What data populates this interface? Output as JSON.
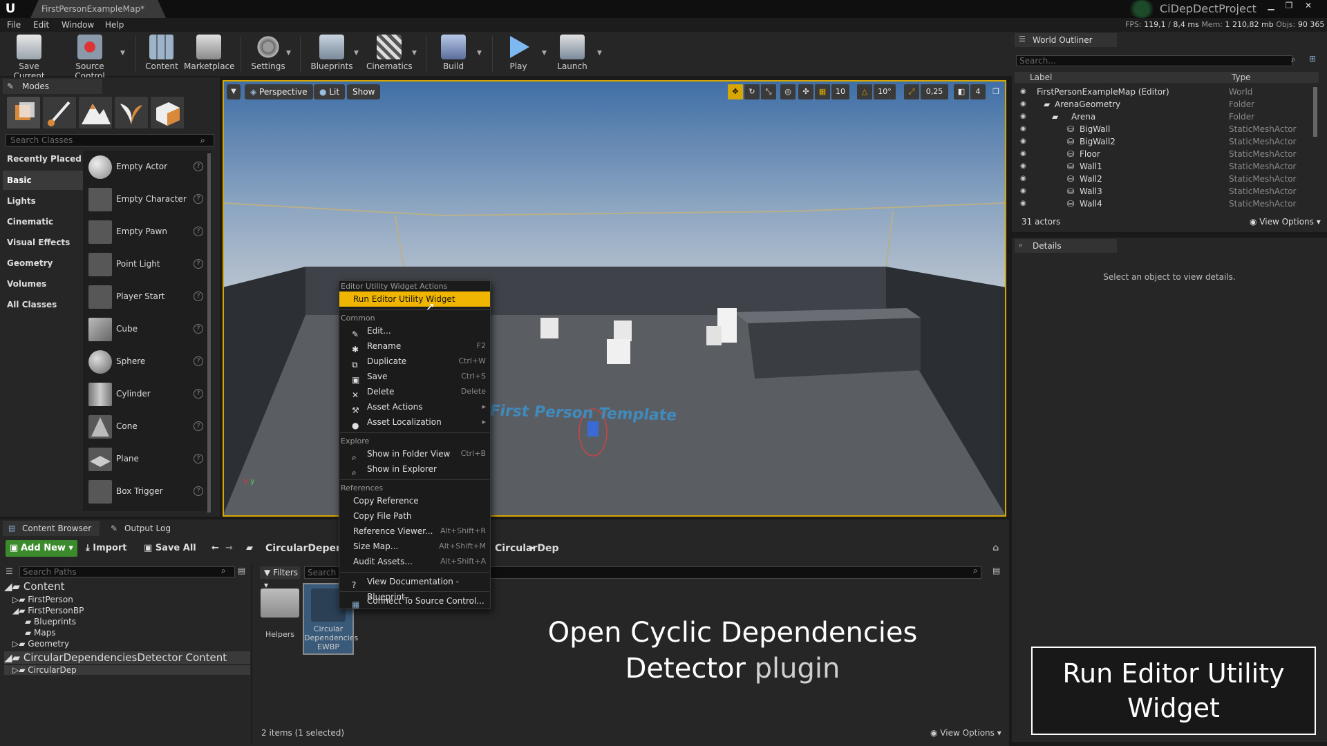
{
  "window": {
    "tab_title": "FirstPersonExampleMap*",
    "project_name": "CiDepDectProject"
  },
  "menu": [
    "File",
    "Edit",
    "Window",
    "Help"
  ],
  "stats": {
    "fps_label": "FPS:",
    "fps": "119,1",
    "ms": "8,4 ms",
    "mem_label": "Mem:",
    "mem": "1 210,82 mb",
    "objs_label": "Objs:",
    "objs": "90 365"
  },
  "toolbar": [
    "Save Current",
    "Source Control",
    "Content",
    "Marketplace",
    "Settings",
    "Blueprints",
    "Cinematics",
    "Build",
    "Play",
    "Launch"
  ],
  "modes": {
    "tab": "Modes",
    "search_placeholder": "Search Classes",
    "categories": [
      "Recently Placed",
      "Basic",
      "Lights",
      "Cinematic",
      "Visual Effects",
      "Geometry",
      "Volumes",
      "All Classes"
    ],
    "selected_category": "Basic",
    "classes": [
      "Empty Actor",
      "Empty Character",
      "Empty Pawn",
      "Point Light",
      "Player Start",
      "Cube",
      "Sphere",
      "Cylinder",
      "Cone",
      "Plane",
      "Box Trigger"
    ]
  },
  "viewport": {
    "perspective": "Perspective",
    "lit": "Lit",
    "show": "Show",
    "grid_snap": "10",
    "rot_snap": "10°",
    "scale_snap": "0,25",
    "cam_speed": "4",
    "floor_text": "First Person Template",
    "axis_x": "x",
    "axis_y": "y"
  },
  "outliner": {
    "tab": "World Outliner",
    "search_placeholder": "Search...",
    "col_label": "Label",
    "col_type": "Type",
    "rows": [
      {
        "label": "FirstPersonExampleMap (Editor)",
        "type": "World"
      },
      {
        "label": "ArenaGeometry",
        "type": "Folder"
      },
      {
        "label": "Arena",
        "type": "Folder"
      },
      {
        "label": "BigWall",
        "type": "StaticMeshActor"
      },
      {
        "label": "BigWall2",
        "type": "StaticMeshActor"
      },
      {
        "label": "Floor",
        "type": "StaticMeshActor"
      },
      {
        "label": "Wall1",
        "type": "StaticMeshActor"
      },
      {
        "label": "Wall2",
        "type": "StaticMeshActor"
      },
      {
        "label": "Wall3",
        "type": "StaticMeshActor"
      },
      {
        "label": "Wall4",
        "type": "StaticMeshActor"
      }
    ],
    "actor_count": "31 actors",
    "view_options": "View Options"
  },
  "details": {
    "tab": "Details",
    "empty_text": "Select an object to view details."
  },
  "content_browser": {
    "tab": "Content Browser",
    "output_log_tab": "Output Log",
    "add_new": "Add New",
    "import": "Import",
    "save_all": "Save All",
    "path_part1": "CircularDependencies",
    "path_part2": "CircularDep",
    "paths_search_placeholder": "Search Paths",
    "filters": "Filters",
    "assets_search_placeholder": "Search CircularDep",
    "tree": [
      "Content",
      "FirstPerson",
      "FirstPersonBP",
      "Blueprints",
      "Maps",
      "Geometry",
      "CircularDependenciesDetector Content",
      "CircularDep"
    ],
    "assets": [
      {
        "name": "Helpers"
      },
      {
        "name": "Circular Dependencies EWBP"
      }
    ],
    "count": "2 items (1 selected)",
    "view_options": "View Options"
  },
  "context_menu": {
    "header": "Editor Utility Widget Actions",
    "primary": "Run Editor Utility Widget",
    "sections": [
      {
        "title": "Common",
        "items": [
          {
            "label": "Edit...",
            "shortcut": ""
          },
          {
            "label": "Rename",
            "shortcut": "F2"
          },
          {
            "label": "Duplicate",
            "shortcut": "Ctrl+W"
          },
          {
            "label": "Save",
            "shortcut": "Ctrl+S"
          },
          {
            "label": "Delete",
            "shortcut": "Delete"
          },
          {
            "label": "Asset Actions",
            "shortcut": ""
          },
          {
            "label": "Asset Localization",
            "shortcut": ""
          }
        ]
      },
      {
        "title": "Explore",
        "items": [
          {
            "label": "Show in Folder View",
            "shortcut": "Ctrl+B"
          },
          {
            "label": "Show in Explorer",
            "shortcut": ""
          }
        ]
      },
      {
        "title": "References",
        "items": [
          {
            "label": "Copy Reference",
            "shortcut": ""
          },
          {
            "label": "Copy File Path",
            "shortcut": ""
          },
          {
            "label": "Reference Viewer...",
            "shortcut": "Alt+Shift+R"
          },
          {
            "label": "Size Map...",
            "shortcut": "Alt+Shift+M"
          },
          {
            "label": "Audit Assets...",
            "shortcut": "Alt+Shift+A"
          }
        ]
      }
    ],
    "view_doc": "View Documentation - Blueprint",
    "source_control": "Connect To Source Control..."
  },
  "captions": {
    "title_line1": "Open Cyclic Dependencies",
    "title_line2a": "Detector",
    "title_line2b": "plugin",
    "callout": "Run Editor Utility Widget"
  },
  "colors": {
    "accent": "#f0b500",
    "add_new": "#3b8a2c",
    "viewport_border": "#d8a600",
    "watermark": "#3f8fc6"
  }
}
